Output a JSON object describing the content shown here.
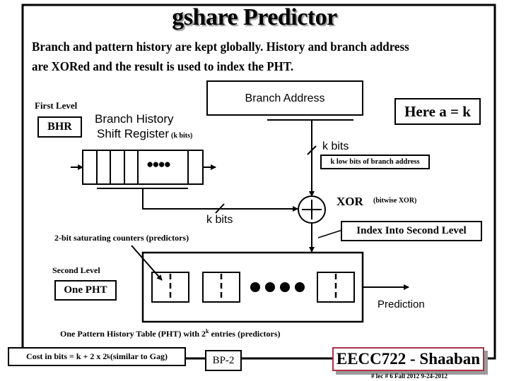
{
  "slide": {
    "title": "gshare Predictor",
    "subtitle_line1": "Branch and pattern history are kept globally. History and branch address",
    "subtitle_line2": "are XORed and the result is used to index the PHT."
  },
  "first_level": {
    "label": "First Level",
    "badge": "BHR",
    "register_title_line1": "Branch History",
    "register_title_line2": "Shift Register",
    "register_bits": "(k bits)",
    "register_ellipsis": "●●●●"
  },
  "branch_address": {
    "label": "Branch Address",
    "note": "Here a = k",
    "bits_label": "k bits",
    "low_bits_note": "k low bits of branch address"
  },
  "xor": {
    "label": "XOR",
    "note": "(bitwise XOR)",
    "history_bits_label": "k bits",
    "index_note": "Index Into Second Level"
  },
  "second_level": {
    "counters_note": "2-bit saturating counters (predictors)",
    "label": "Second Level",
    "badge": "One PHT",
    "table_caption_pre": "One Pattern History Table (PHT) with 2",
    "table_caption_sup": "k",
    "table_caption_post": " entries (predictors)",
    "output_label": "Prediction"
  },
  "footer": {
    "cost_pre": "Cost in bits = k + 2 x 2",
    "cost_sup": "k",
    "cost_post": " (similar to Gag)",
    "slide_id": "BP-2",
    "course": "EECC722 - Shaaban",
    "lecture_info": "#  lec # 6   Fall 2012   9-24-2012"
  },
  "colors": {
    "frame": "#000000",
    "course_border": "#b03048",
    "shadow": "#9a9a9a"
  }
}
